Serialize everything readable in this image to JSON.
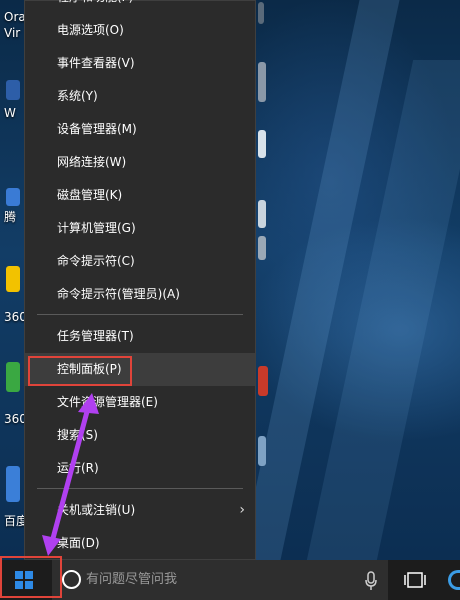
{
  "menu": {
    "items": [
      {
        "label": "程序和功能(F)"
      },
      {
        "label": "电源选项(O)"
      },
      {
        "label": "事件查看器(V)"
      },
      {
        "label": "系统(Y)"
      },
      {
        "label": "设备管理器(M)"
      },
      {
        "label": "网络连接(W)"
      },
      {
        "label": "磁盘管理(K)"
      },
      {
        "label": "计算机管理(G)"
      },
      {
        "label": "命令提示符(C)"
      },
      {
        "label": "命令提示符(管理员)(A)"
      },
      {
        "label": "任务管理器(T)"
      },
      {
        "label": "控制面板(P)",
        "highlighted": true
      },
      {
        "label": "文件资源管理器(E)"
      },
      {
        "label": "搜索(S)"
      },
      {
        "label": "运行(R)"
      },
      {
        "label": "关机或注销(U)",
        "has_submenu": true
      },
      {
        "label": "桌面(D)"
      }
    ],
    "submenu_arrow": "chevron-right-icon"
  },
  "desktop": {
    "icons": [
      {
        "label": "Ora",
        "label2": "Vir"
      },
      {
        "label": "W"
      },
      {
        "label": "腾"
      },
      {
        "label": "360"
      },
      {
        "label": "360"
      },
      {
        "label": "百度"
      }
    ]
  },
  "taskbar": {
    "start_icon": "windows-logo-icon",
    "search_placeholder": "有问题尽管问我",
    "cortana_icon": "cortana-circle-icon",
    "mic_icon": "microphone-icon",
    "taskview_icon": "task-view-icon"
  },
  "annotations": {
    "highlight_color": "#e0443a",
    "arrow_color": "#b040f0"
  },
  "colors": {
    "menu_bg": "#2b2b2b",
    "menu_hover": "#3d3d3d",
    "taskbar_bg": "#1c1c1c",
    "accent": "#2e8ae6"
  }
}
